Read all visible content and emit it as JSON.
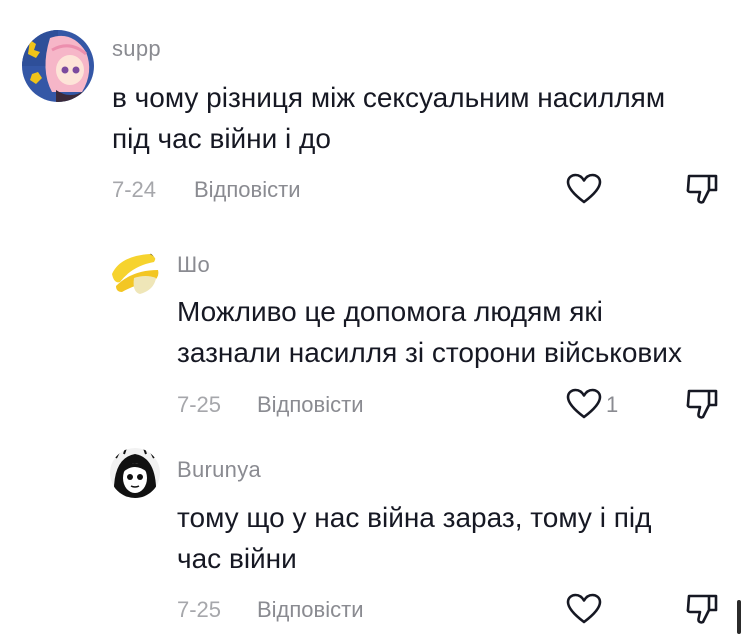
{
  "comments": [
    {
      "username": "supp",
      "text": "в чому різниця між сексуальним насиллям\nпід час війни і до",
      "date": "7-24",
      "reply_label": "Відповісти",
      "like_count": ""
    },
    {
      "username": "Шо",
      "text": "Можливо це допомога людям які\nзазнали насилля зі сторони військових",
      "date": "7-25",
      "reply_label": "Відповісти",
      "like_count": "1"
    },
    {
      "username": "Burunya",
      "text": "тому що у нас війна зараз, тому і під\nчас війни",
      "date": "7-25",
      "reply_label": "Відповісти",
      "like_count": ""
    }
  ],
  "icons": {
    "like": "heart-outline-icon",
    "dislike": "thumbs-down-outline-icon"
  },
  "colors": {
    "text": "#161823",
    "secondary": "#8a8b91",
    "date": "#a6a7ab"
  }
}
